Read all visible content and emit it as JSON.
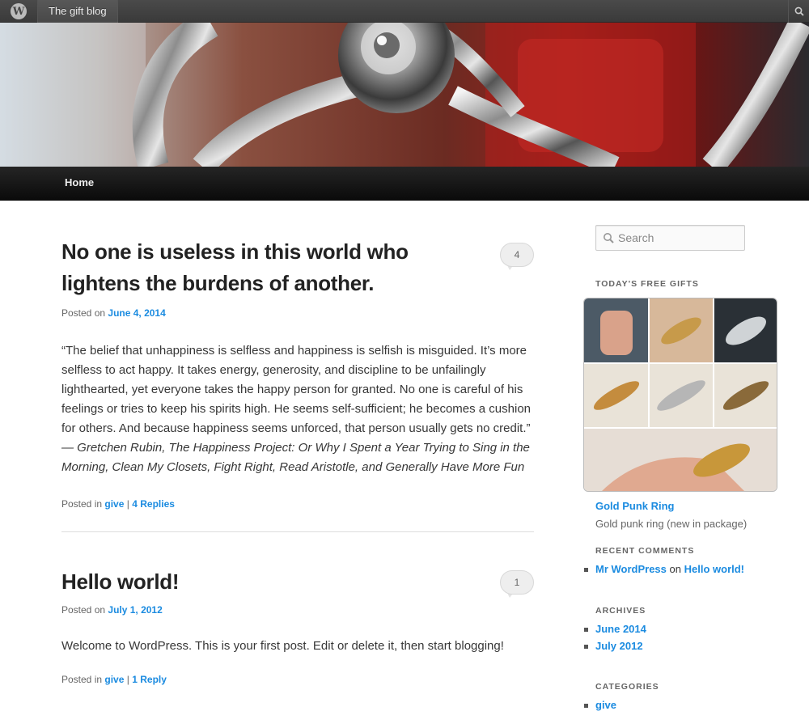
{
  "admin_bar": {
    "site_name": "The gift blog",
    "wp_logo_icon": "wordpress-logo-icon",
    "search_icon": "search-icon"
  },
  "nav": {
    "items": [
      {
        "label": "Home"
      }
    ]
  },
  "posts": [
    {
      "title": "No one is useless in this world who lightens the burdens of another.",
      "posted_on_label": "Posted on",
      "date": "June 4, 2014",
      "comment_count": "4",
      "body": "“The belief that unhappiness is selfless and happiness is selfish is misguided. It’s more selfless to act happy. It takes energy, generosity, and discipline to be unfailingly lighthearted, yet everyone takes the happy person for granted. No one is careful of his feelings or tries to keep his spirits high. He seems self-sufficient; he becomes a cushion for others. And because happiness seems unforced, that person usually gets no credit.”",
      "citation": "― Gretchen Rubin, The Happiness Project: Or Why I Spent a Year Trying to Sing in the Morning, Clean My Closets, Fight Right, Read Aristotle, and Generally Have More Fun",
      "posted_in_label": "Posted in",
      "category": "give",
      "separator": "|",
      "replies": "4 Replies"
    },
    {
      "title": "Hello world!",
      "posted_on_label": "Posted on",
      "date": "July 1, 2012",
      "comment_count": "1",
      "body": "Welcome to WordPress. This is your first post. Edit or delete it, then start blogging!",
      "posted_in_label": "Posted in",
      "category": "give",
      "separator": "|",
      "replies": "1 Reply"
    }
  ],
  "sidebar": {
    "search": {
      "placeholder": "Search"
    },
    "free_gifts": {
      "title": "TODAY'S FREE GIFTS",
      "gift_name": "Gold Punk Ring",
      "gift_description": "Gold punk ring (new in package)"
    },
    "recent_comments": {
      "title": "RECENT COMMENTS",
      "author": "Mr WordPress",
      "on_label": "on",
      "post": "Hello world!"
    },
    "archives": {
      "title": "ARCHIVES",
      "items": [
        "June 2014",
        "July 2012"
      ]
    },
    "categories": {
      "title": "CATEGORIES",
      "items": [
        "give"
      ]
    }
  },
  "colors": {
    "link": "#1b8be0",
    "admin_bar": "#464646",
    "nav_bar": "#151515"
  }
}
